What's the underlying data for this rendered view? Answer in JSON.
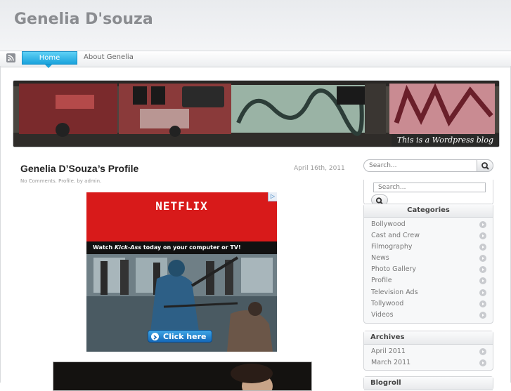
{
  "site": {
    "title": "Genelia D'souza",
    "tagline": "This is a Wordpress blog"
  },
  "nav": {
    "items": [
      {
        "label": "Home",
        "active": true
      },
      {
        "label": "About Genelia",
        "active": false
      }
    ]
  },
  "post": {
    "title": "Genelia D’Souza’s Profile",
    "date": "April 16th, 2011",
    "meta": "No Comments. Profile. by admin."
  },
  "ad": {
    "brand": "NETFLIX",
    "strip_prefix": "Watch ",
    "strip_title": "Kick-Ass",
    "strip_suffix": " today on your computer or TV!",
    "button_label": "Click here",
    "choices_icon": "adchoices-icon"
  },
  "sidebar": {
    "search_top": {
      "placeholder": "Search..."
    },
    "search_widget": {
      "placeholder": "Search..."
    },
    "categories": {
      "title": "Categories",
      "items": [
        "Bollywood",
        "Cast and Crew",
        "Filmography",
        "News",
        "Photo Gallery",
        "Profile",
        "Television Ads",
        "Tollywood",
        "Videos"
      ]
    },
    "archives": {
      "title": "Archives",
      "items": [
        "April 2011",
        "March 2011"
      ]
    },
    "blogroll": {
      "title": "Blogroll"
    }
  },
  "colors": {
    "accent": "#1aa3dc",
    "ad_red": "#d81a1a",
    "title_gray": "#8a8c90"
  }
}
